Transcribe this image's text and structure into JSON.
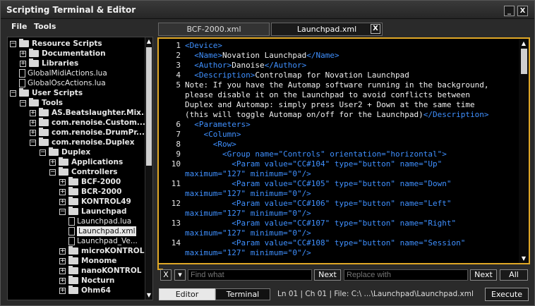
{
  "window": {
    "title": "Scripting Terminal & Editor",
    "min_label": "_",
    "close_label": "X"
  },
  "menu": {
    "file": "File",
    "tools": "Tools"
  },
  "tree": {
    "items": [
      {
        "depth": 0,
        "type": "folder",
        "expanded": true,
        "label": "Resource Scripts",
        "bold": true
      },
      {
        "depth": 1,
        "type": "folder",
        "expanded": false,
        "label": "Documentation",
        "bold": true
      },
      {
        "depth": 1,
        "type": "folder",
        "expanded": false,
        "label": "Libraries",
        "bold": true
      },
      {
        "depth": 1,
        "type": "file",
        "label": "GlobalMidiActions.lua"
      },
      {
        "depth": 1,
        "type": "file",
        "label": "GlobalOscActions.lua"
      },
      {
        "depth": 0,
        "type": "folder",
        "expanded": true,
        "label": "User Scripts",
        "bold": true
      },
      {
        "depth": 1,
        "type": "folder",
        "expanded": true,
        "label": "Tools",
        "bold": true
      },
      {
        "depth": 2,
        "type": "folder",
        "expanded": false,
        "label": "AS.Beatslaughter.Mix...",
        "bold": true
      },
      {
        "depth": 2,
        "type": "folder",
        "expanded": false,
        "label": "com.renoise.Custom...",
        "bold": true
      },
      {
        "depth": 2,
        "type": "folder",
        "expanded": false,
        "label": "com.renoise.DrumPr...",
        "bold": true
      },
      {
        "depth": 2,
        "type": "folder",
        "expanded": true,
        "label": "com.renoise.Duplex",
        "bold": true
      },
      {
        "depth": 3,
        "type": "folder",
        "expanded": true,
        "label": "Duplex",
        "bold": true
      },
      {
        "depth": 4,
        "type": "folder",
        "expanded": false,
        "label": "Applications",
        "bold": true
      },
      {
        "depth": 4,
        "type": "folder",
        "expanded": true,
        "label": "Controllers",
        "bold": true
      },
      {
        "depth": 5,
        "type": "folder",
        "expanded": false,
        "label": "BCF-2000",
        "bold": true
      },
      {
        "depth": 5,
        "type": "folder",
        "expanded": false,
        "label": "BCR-2000",
        "bold": true
      },
      {
        "depth": 5,
        "type": "folder",
        "expanded": false,
        "label": "KONTROL49",
        "bold": true
      },
      {
        "depth": 5,
        "type": "folder",
        "expanded": true,
        "label": "Launchpad",
        "bold": true
      },
      {
        "depth": 6,
        "type": "file",
        "label": "Launchpad.lua"
      },
      {
        "depth": 6,
        "type": "file",
        "label": "Launchpad.xml",
        "selected": true
      },
      {
        "depth": 6,
        "type": "file",
        "label": "Launchpad_Ve..."
      },
      {
        "depth": 5,
        "type": "folder",
        "expanded": false,
        "label": "microKONTROL",
        "bold": true
      },
      {
        "depth": 5,
        "type": "folder",
        "expanded": false,
        "label": "Monome",
        "bold": true
      },
      {
        "depth": 5,
        "type": "folder",
        "expanded": false,
        "label": "nanoKONTROL",
        "bold": true
      },
      {
        "depth": 5,
        "type": "folder",
        "expanded": false,
        "label": "Nocturn",
        "bold": true
      },
      {
        "depth": 5,
        "type": "folder",
        "expanded": false,
        "label": "Ohm64",
        "bold": true
      }
    ]
  },
  "tabs": [
    {
      "label": "BCF-2000.xml",
      "active": false
    },
    {
      "label": "Launchpad.xml",
      "active": true
    }
  ],
  "tab_close_label": "X",
  "editor": {
    "lines": [
      {
        "n": "1",
        "html": [
          [
            "t",
            "<Device>"
          ]
        ]
      },
      {
        "n": "2",
        "html": [
          [
            "t",
            "  <Name>"
          ],
          [
            "p",
            "Novation Launchpad"
          ],
          [
            "t",
            "</Name>"
          ]
        ]
      },
      {
        "n": "3",
        "html": [
          [
            "t",
            "  <Author>"
          ],
          [
            "p",
            "Danoise"
          ],
          [
            "t",
            "</Author>"
          ]
        ]
      },
      {
        "n": "4",
        "html": [
          [
            "t",
            "  <Description>"
          ],
          [
            "p",
            "Controlmap for Novation Launchpad"
          ]
        ]
      },
      {
        "n": "5",
        "html": [
          [
            "p",
            "Note: If you have the Automap software running in the background,"
          ]
        ]
      },
      {
        "n": "",
        "html": [
          [
            "p",
            "please disable it on the Launchpad to avoid conflicts between"
          ]
        ]
      },
      {
        "n": "",
        "html": [
          [
            "p",
            "Duplex and Automap: simply press User2 + Down at the same time"
          ]
        ]
      },
      {
        "n": "",
        "html": [
          [
            "p",
            "(this will toggle Automap on/off for the Launchpad)"
          ],
          [
            "t",
            "</Description>"
          ]
        ]
      },
      {
        "n": "6",
        "html": [
          [
            "t",
            "  <Parameters>"
          ]
        ]
      },
      {
        "n": "7",
        "html": [
          [
            "t",
            "    <Column>"
          ]
        ]
      },
      {
        "n": "8",
        "html": [
          [
            "t",
            "      <Row>"
          ]
        ]
      },
      {
        "n": "9",
        "html": [
          [
            "t",
            "        <Group name=\"Controls\" orientation=\"horizontal\">"
          ]
        ]
      },
      {
        "n": "10",
        "html": [
          [
            "t",
            "          <Param value=\"CC#104\" type=\"button\" name=\"Up\""
          ]
        ]
      },
      {
        "n": "",
        "html": [
          [
            "t",
            "maximum=\"127\" minimum=\"0\"/>"
          ]
        ]
      },
      {
        "n": "11",
        "html": [
          [
            "t",
            "          <Param value=\"CC#105\" type=\"button\" name=\"Down\""
          ]
        ]
      },
      {
        "n": "",
        "html": [
          [
            "t",
            "maximum=\"127\" minimum=\"0\"/>"
          ]
        ]
      },
      {
        "n": "12",
        "html": [
          [
            "t",
            "          <Param value=\"CC#106\" type=\"button\" name=\"Left\""
          ]
        ]
      },
      {
        "n": "",
        "html": [
          [
            "t",
            "maximum=\"127\" minimum=\"0\"/>"
          ]
        ]
      },
      {
        "n": "13",
        "html": [
          [
            "t",
            "          <Param value=\"CC#107\" type=\"button\" name=\"Right\""
          ]
        ]
      },
      {
        "n": "",
        "html": [
          [
            "t",
            "maximum=\"127\" minimum=\"0\"/>"
          ]
        ]
      },
      {
        "n": "14",
        "html": [
          [
            "t",
            "          <Param value=\"CC#108\" type=\"button\" name=\"Session\""
          ]
        ]
      },
      {
        "n": "",
        "html": [
          [
            "t",
            "maximum=\"127\" minimum=\"0\"/>"
          ]
        ]
      }
    ]
  },
  "find": {
    "close_label": "X",
    "dropdown_label": "▾",
    "find_placeholder": "Find what",
    "next_label": "Next",
    "replace_placeholder": "Replace with",
    "next2_label": "Next",
    "all_label": "All"
  },
  "bottom": {
    "editor_label": "Editor",
    "terminal_label": "Terminal",
    "status": "Ln 01 | Ch 01 | File: C:\\ ...\\Launchpad\\Launchpad.xml",
    "execute_label": "Execute"
  },
  "colors": {
    "accent": "#e0a826",
    "tag": "#3f90ff",
    "selection": "#e8e8e8"
  }
}
